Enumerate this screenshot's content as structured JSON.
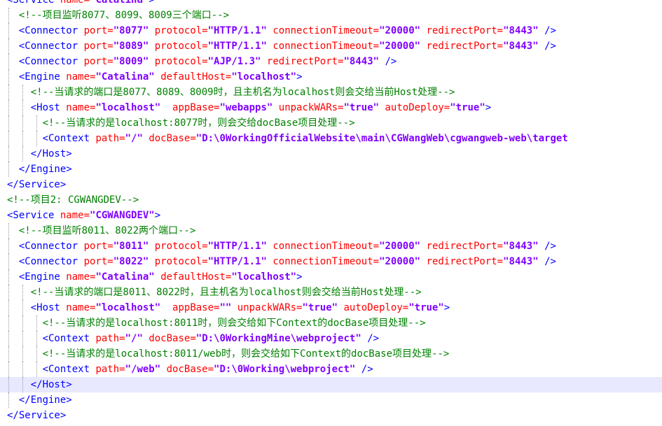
{
  "editor": {
    "current_line_index": 25,
    "lines": [
      {
        "indent": 0,
        "tokens": [
          [
            "tag",
            "<Service "
          ],
          [
            "attr",
            "name="
          ],
          [
            "val",
            "\"Catalina\""
          ],
          [
            "tag",
            ">"
          ]
        ]
      },
      {
        "indent": 1,
        "tokens": [
          [
            "comment",
            "<!--项目监听8077、8099、8009三个端口-->"
          ]
        ]
      },
      {
        "indent": 1,
        "tokens": [
          [
            "tag",
            "<Connector "
          ],
          [
            "attr",
            "port="
          ],
          [
            "val",
            "\"8077\""
          ],
          [
            "tag",
            " "
          ],
          [
            "attr",
            "protocol="
          ],
          [
            "val",
            "\"HTTP/1.1\""
          ],
          [
            "tag",
            " "
          ],
          [
            "attr",
            "connectionTimeout="
          ],
          [
            "val",
            "\"20000\""
          ],
          [
            "tag",
            " "
          ],
          [
            "attr",
            "redirectPort="
          ],
          [
            "val",
            "\"8443\""
          ],
          [
            "tag",
            " />"
          ]
        ]
      },
      {
        "indent": 1,
        "tokens": [
          [
            "tag",
            "<Connector "
          ],
          [
            "attr",
            "port="
          ],
          [
            "val",
            "\"8089\""
          ],
          [
            "tag",
            " "
          ],
          [
            "attr",
            "protocol="
          ],
          [
            "val",
            "\"HTTP/1.1\""
          ],
          [
            "tag",
            " "
          ],
          [
            "attr",
            "connectionTimeout="
          ],
          [
            "val",
            "\"20000\""
          ],
          [
            "tag",
            " "
          ],
          [
            "attr",
            "redirectPort="
          ],
          [
            "val",
            "\"8443\""
          ],
          [
            "tag",
            " />"
          ]
        ]
      },
      {
        "indent": 1,
        "tokens": [
          [
            "tag",
            "<Connector "
          ],
          [
            "attr",
            "port="
          ],
          [
            "val",
            "\"8009\""
          ],
          [
            "tag",
            " "
          ],
          [
            "attr",
            "protocol="
          ],
          [
            "val",
            "\"AJP/1.3\""
          ],
          [
            "tag",
            " "
          ],
          [
            "attr",
            "redirectPort="
          ],
          [
            "val",
            "\"8443\""
          ],
          [
            "tag",
            " />"
          ]
        ]
      },
      {
        "indent": 1,
        "tokens": [
          [
            "tag",
            "<Engine "
          ],
          [
            "attr",
            "name="
          ],
          [
            "val",
            "\"Catalina\""
          ],
          [
            "tag",
            " "
          ],
          [
            "attr",
            "defaultHost="
          ],
          [
            "val",
            "\"localhost\""
          ],
          [
            "tag",
            ">"
          ]
        ]
      },
      {
        "indent": 2,
        "tokens": [
          [
            "comment",
            "<!--当请求的端口是8077、8089、8009时，且主机名为localhost则会交给当前Host处理-->"
          ]
        ]
      },
      {
        "indent": 2,
        "tokens": [
          [
            "tag",
            "<Host "
          ],
          [
            "attr",
            "name="
          ],
          [
            "val",
            "\"localhost\""
          ],
          [
            "tag",
            "  "
          ],
          [
            "attr",
            "appBase="
          ],
          [
            "val",
            "\"webapps\""
          ],
          [
            "tag",
            " "
          ],
          [
            "attr",
            "unpackWARs="
          ],
          [
            "val",
            "\"true\""
          ],
          [
            "tag",
            " "
          ],
          [
            "attr",
            "autoDeploy="
          ],
          [
            "val",
            "\"true\""
          ],
          [
            "tag",
            ">"
          ]
        ]
      },
      {
        "indent": 3,
        "tokens": [
          [
            "comment",
            "<!--当请求的是localhost:8077时，则会交给docBase项目处理-->"
          ]
        ]
      },
      {
        "indent": 3,
        "tokens": [
          [
            "tag",
            "<Context "
          ],
          [
            "attr",
            "path="
          ],
          [
            "val",
            "\"/\""
          ],
          [
            "tag",
            " "
          ],
          [
            "attr",
            "docBase="
          ],
          [
            "val",
            "\"D:\\0WorkingOfficialWebsite\\main\\CGWangWeb\\cgwangweb-web\\target"
          ]
        ]
      },
      {
        "indent": 2,
        "tokens": [
          [
            "tag",
            "</Host>"
          ]
        ]
      },
      {
        "indent": 1,
        "tokens": [
          [
            "tag",
            "</Engine>"
          ]
        ]
      },
      {
        "indent": 0,
        "tokens": [
          [
            "tag",
            "</Service>"
          ]
        ]
      },
      {
        "indent": 0,
        "tokens": [
          [
            "comment",
            "<!--项目2: CGWANGDEV-->"
          ]
        ]
      },
      {
        "indent": 0,
        "tokens": [
          [
            "tag",
            "<Service "
          ],
          [
            "attr",
            "name="
          ],
          [
            "val",
            "\"CGWANGDEV\""
          ],
          [
            "tag",
            ">"
          ]
        ]
      },
      {
        "indent": 1,
        "tokens": [
          [
            "comment",
            "<!--项目监听8011、8022两个端口-->"
          ]
        ]
      },
      {
        "indent": 1,
        "tokens": [
          [
            "tag",
            "<Connector "
          ],
          [
            "attr",
            "port="
          ],
          [
            "val",
            "\"8011\""
          ],
          [
            "tag",
            " "
          ],
          [
            "attr",
            "protocol="
          ],
          [
            "val",
            "\"HTTP/1.1\""
          ],
          [
            "tag",
            " "
          ],
          [
            "attr",
            "connectionTimeout="
          ],
          [
            "val",
            "\"20000\""
          ],
          [
            "tag",
            " "
          ],
          [
            "attr",
            "redirectPort="
          ],
          [
            "val",
            "\"8443\""
          ],
          [
            "tag",
            " />"
          ]
        ]
      },
      {
        "indent": 1,
        "tokens": [
          [
            "tag",
            "<Connector "
          ],
          [
            "attr",
            "port="
          ],
          [
            "val",
            "\"8022\""
          ],
          [
            "tag",
            " "
          ],
          [
            "attr",
            "protocol="
          ],
          [
            "val",
            "\"HTTP/1.1\""
          ],
          [
            "tag",
            " "
          ],
          [
            "attr",
            "connectionTimeout="
          ],
          [
            "val",
            "\"20000\""
          ],
          [
            "tag",
            " "
          ],
          [
            "attr",
            "redirectPort="
          ],
          [
            "val",
            "\"8443\""
          ],
          [
            "tag",
            " />"
          ]
        ]
      },
      {
        "indent": 1,
        "tokens": [
          [
            "tag",
            "<Engine "
          ],
          [
            "attr",
            "name="
          ],
          [
            "val",
            "\"Catalina\""
          ],
          [
            "tag",
            " "
          ],
          [
            "attr",
            "defaultHost="
          ],
          [
            "val",
            "\"localhost\""
          ],
          [
            "tag",
            ">"
          ]
        ]
      },
      {
        "indent": 2,
        "tokens": [
          [
            "comment",
            "<!--当请求的端口是8011、8022时，且主机名为localhost则会交给当前Host处理-->"
          ]
        ]
      },
      {
        "indent": 2,
        "tokens": [
          [
            "tag",
            "<Host "
          ],
          [
            "attr",
            "name="
          ],
          [
            "val",
            "\"localhost\""
          ],
          [
            "tag",
            "  "
          ],
          [
            "attr",
            "appBase="
          ],
          [
            "val",
            "\"\""
          ],
          [
            "tag",
            " "
          ],
          [
            "attr",
            "unpackWARs="
          ],
          [
            "val",
            "\"true\""
          ],
          [
            "tag",
            " "
          ],
          [
            "attr",
            "autoDeploy="
          ],
          [
            "val",
            "\"true\""
          ],
          [
            "tag",
            ">"
          ]
        ]
      },
      {
        "indent": 3,
        "tokens": [
          [
            "comment",
            "<!--当请求的是localhost:8011时，则会交给如下Context的docBase项目处理-->"
          ]
        ]
      },
      {
        "indent": 3,
        "tokens": [
          [
            "tag",
            "<Context "
          ],
          [
            "attr",
            "path="
          ],
          [
            "val",
            "\"/\""
          ],
          [
            "tag",
            " "
          ],
          [
            "attr",
            "docBase="
          ],
          [
            "val",
            "\"D:\\0WorkingMine\\webproject\""
          ],
          [
            "tag",
            " />"
          ]
        ]
      },
      {
        "indent": 3,
        "tokens": [
          [
            "comment",
            "<!--当请求的是localhost:8011/web时，则会交给如下Context的docBase项目处理-->"
          ]
        ]
      },
      {
        "indent": 3,
        "tokens": [
          [
            "tag",
            "<Context "
          ],
          [
            "attr",
            "path="
          ],
          [
            "val",
            "\"/web\""
          ],
          [
            "tag",
            " "
          ],
          [
            "attr",
            "docBase="
          ],
          [
            "val",
            "\"D:\\0Working\\webproject\""
          ],
          [
            "tag",
            " />"
          ]
        ]
      },
      {
        "indent": 2,
        "tokens": [
          [
            "tag",
            "</Host>"
          ]
        ]
      },
      {
        "indent": 1,
        "tokens": [
          [
            "tag",
            "</Engine>"
          ]
        ]
      },
      {
        "indent": 0,
        "tokens": [
          [
            "tag",
            "</Service>"
          ]
        ]
      }
    ]
  },
  "colors": {
    "tag": "#0000ff",
    "attribute": "#ff0000",
    "value": "#8000ff",
    "comment": "#008000",
    "current_line": "#e8e8ff"
  }
}
